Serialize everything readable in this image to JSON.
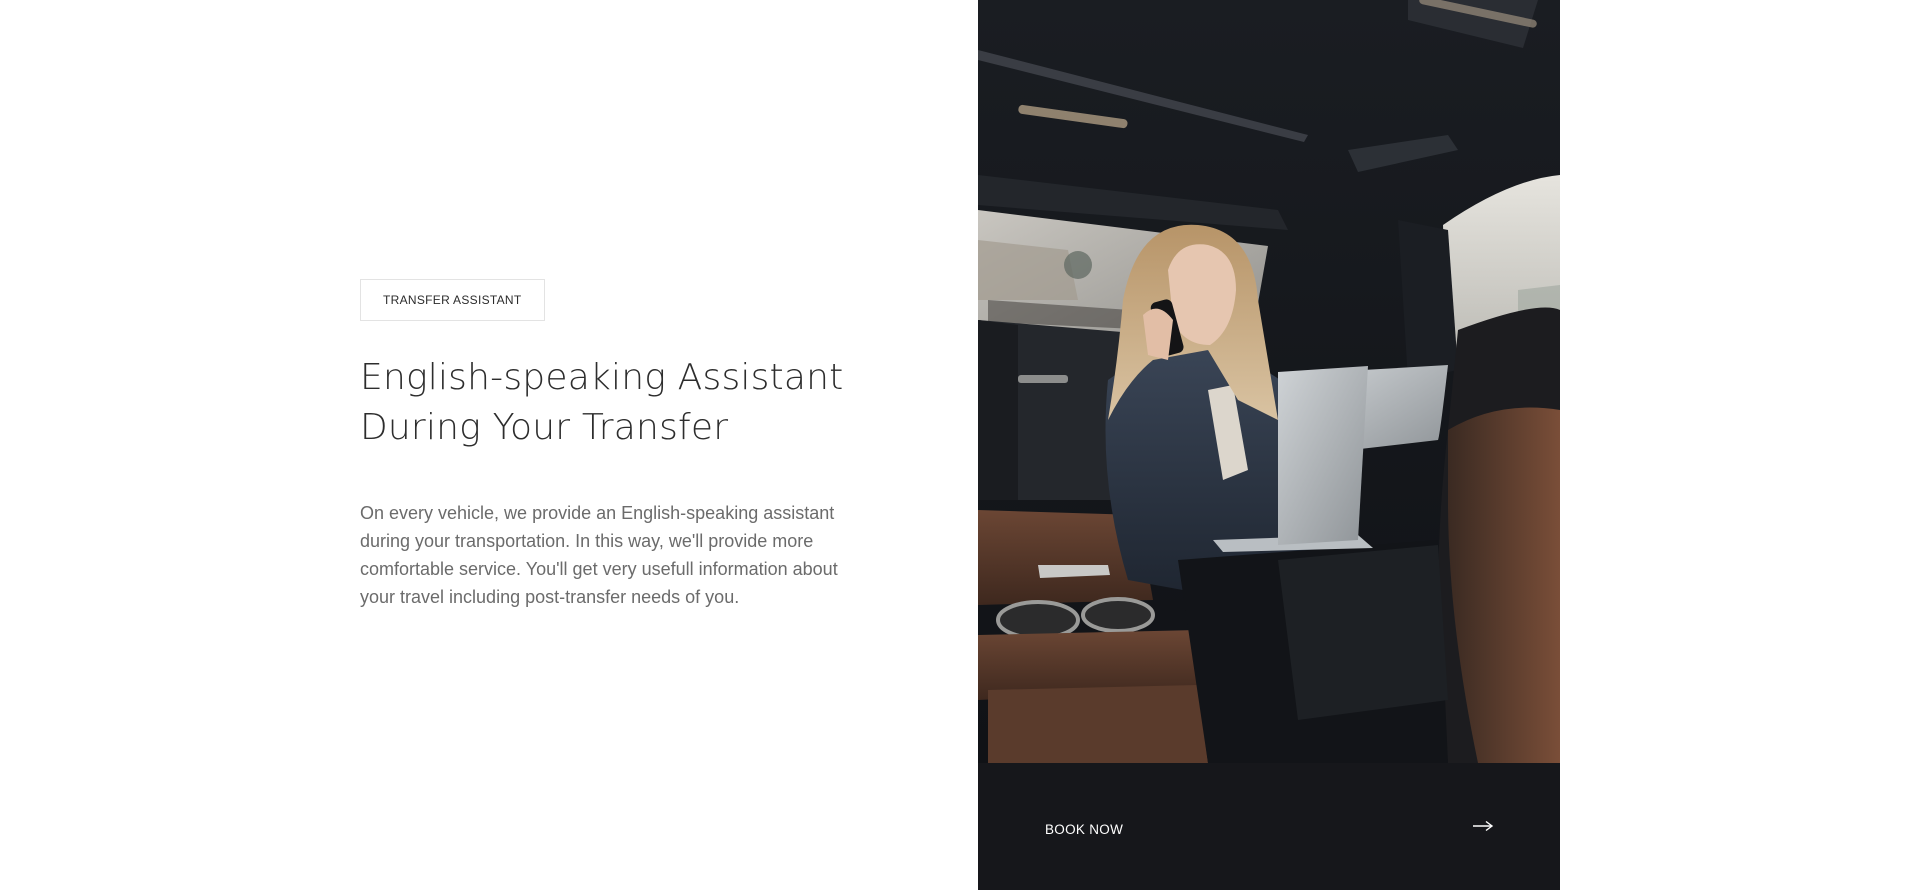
{
  "section": {
    "tag_label": "TRANSFER ASSISTANT",
    "heading_line1": "English-speaking Assistant",
    "heading_line2": "During Your Transfer",
    "description": "On every vehicle, we provide an English-speaking assistant during your transportation. In this way, we'll provide more comfortable service. You'll get very usefull information about your travel including post-transfer needs of you."
  },
  "cta": {
    "label": "BOOK NOW",
    "icon": "arrow-right-icon"
  },
  "image": {
    "subject": "woman-on-phone-with-laptop-in-car-photo"
  },
  "colors": {
    "cta_background": "#16171b",
    "heading": "#2d2d2d",
    "body_text": "#6b6b6b",
    "tag_border": "#e3e3e3"
  }
}
